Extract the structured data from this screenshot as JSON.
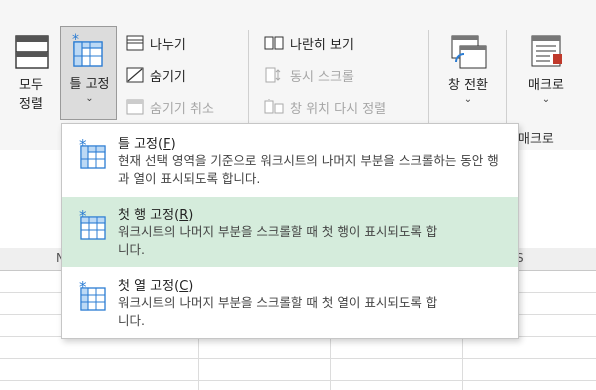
{
  "ribbon": {
    "reset_label_line1": "모두",
    "reset_label_line2": "정렬",
    "freeze_panes_label": "틀 고정",
    "split_label": "나누기",
    "hide_label": "숨기기",
    "unhide_label": "숨기기 취소",
    "side_by_side_label": "나란히 보기",
    "sync_scroll_label": "동시 스크롤",
    "reset_position_label": "창 위치 다시 정렬",
    "switch_windows_label": "창 전환",
    "macros_label": "매크로",
    "macros_group_label": "매크로",
    "chevron": "⌄"
  },
  "sheet": {
    "col_fragment_left": "N",
    "col_fragment_right": "S"
  },
  "menu": {
    "items": [
      {
        "title_main": "틀 고정(",
        "title_key": "F",
        "title_end": ")",
        "desc": "현재 선택 영역을 기준으로 워크시트의 나머지 부분을 스크롤하는 동안 행과 열이 표시되도록 합니다."
      },
      {
        "title_main": "첫 행 고정(",
        "title_key": "R",
        "title_end": ")",
        "desc": "워크시트의 나머지 부분을 스크롤할 때 첫 행이 표시되도록 합니다."
      },
      {
        "title_main": "첫 열 고정(",
        "title_key": "C",
        "title_end": ")",
        "desc": "워크시트의 나머지 부분을 스크롤할 때 첫 열이 표시되도록 합니다."
      }
    ]
  },
  "colors": {
    "highlight": "#d5ecdc",
    "icon_blue": "#2b7cd3",
    "icon_fill": "#bcd9f5"
  }
}
